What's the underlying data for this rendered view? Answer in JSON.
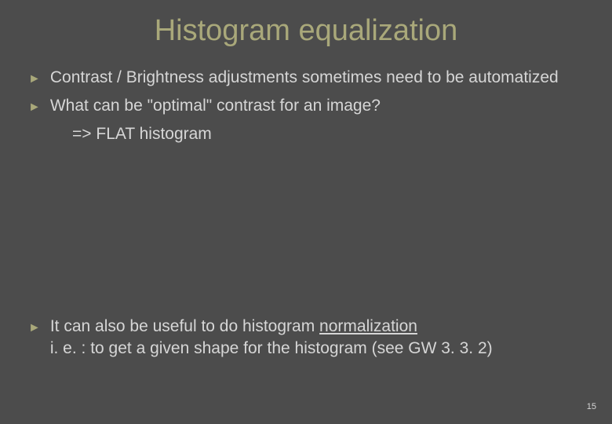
{
  "title": "Histogram equalization",
  "bullets": {
    "b1": "Contrast / Brightness adjustments sometimes need to be automatized",
    "b2": "What can be \"optimal\" contrast for an image?",
    "b2_sub": "=> FLAT histogram",
    "b3_pre": "It can also be useful to do histogram ",
    "b3_underline": "normalization",
    "b3_line2": "i. e. : to get a given shape for the histogram (see GW 3. 3. 2)"
  },
  "page_number": "15"
}
